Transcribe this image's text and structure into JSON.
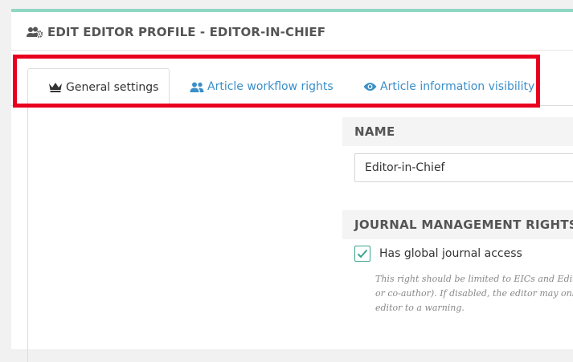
{
  "panel": {
    "title": "EDIT EDITOR PROFILE - EDITOR-IN-CHIEF",
    "title_icon": "users-cog-icon"
  },
  "tabs": [
    {
      "label": "General settings",
      "icon": "crown-icon",
      "active": true
    },
    {
      "label": "Article workflow rights",
      "icon": "users-icon",
      "active": false
    },
    {
      "label": "Article information visibility",
      "icon": "eye-icon",
      "active": false
    }
  ],
  "name_section": {
    "heading": "NAME",
    "value": "Editor-in-Chief"
  },
  "journal_section": {
    "heading": "JOURNAL MANAGEMENT RIGHTS",
    "global_access_label": "Has global journal access",
    "global_access_checked": true,
    "help_lines": [
      "This right should be limited to EICs and Editoria",
      "or co-author). If disabled, the editor may only ac",
      "editor to a warning."
    ]
  },
  "colors": {
    "accent_top": "#8fd8c5",
    "link": "#3a8fc9",
    "highlight": "#e8001f",
    "check": "#3aa58e"
  }
}
